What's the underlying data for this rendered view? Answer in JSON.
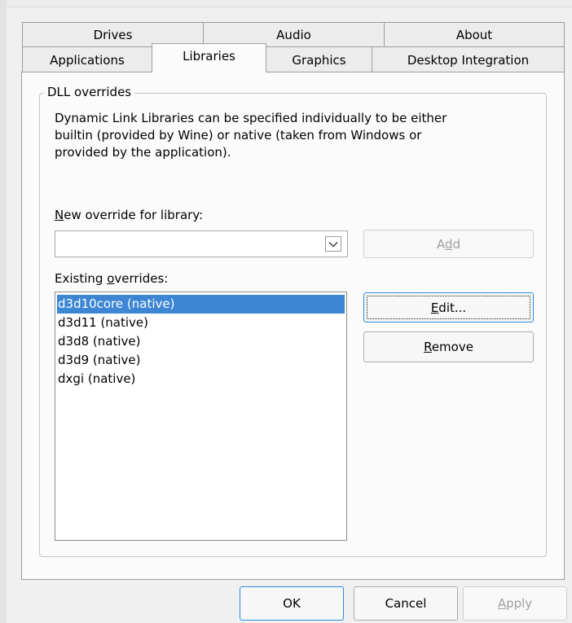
{
  "tabs_row1": [
    {
      "label": "Drives"
    },
    {
      "label": "Audio"
    },
    {
      "label": "About"
    }
  ],
  "tabs_row2": [
    {
      "label": "Applications"
    },
    {
      "label": "Libraries"
    },
    {
      "label": "Graphics"
    },
    {
      "label": "Desktop Integration"
    }
  ],
  "active_tab": "Libraries",
  "dll": {
    "group_title": "DLL overrides",
    "description_lines": [
      "Dynamic Link Libraries can be specified individually to be either",
      "builtin (provided by Wine) or native (taken from Windows or",
      "provided by the application)."
    ],
    "new_override_label_prefix": "N",
    "new_override_label_rest": "ew override for library:",
    "new_override_value": "",
    "add_prefix": "A",
    "add_mnemonic": "d",
    "add_rest": "d",
    "existing_label_prefix": "Existing ",
    "existing_label_mnemonic": "o",
    "existing_label_rest": "verrides:",
    "overrides": [
      "d3d10core (native)",
      "d3d11 (native)",
      "d3d8 (native)",
      "d3d9 (native)",
      "dxgi (native)"
    ],
    "selected_override": "d3d10core (native)",
    "edit_mnemonic": "E",
    "edit_rest": "dit...",
    "remove_mnemonic": "R",
    "remove_rest": "emove"
  },
  "footer": {
    "ok_label": "OK",
    "cancel_label": "Cancel",
    "apply_mnemonic": "A",
    "apply_rest": "pply"
  },
  "colors": {
    "selection": "#3c86d4",
    "default_button_border": "#2b8be0",
    "window_bg": "#f0f0f0",
    "panel_bg": "#fbfbfb"
  }
}
